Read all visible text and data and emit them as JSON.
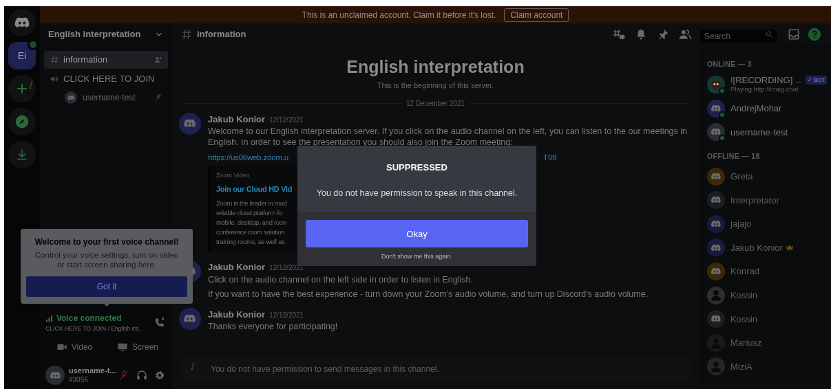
{
  "banner": {
    "text": "This is an unclaimed account. Claim it before it's lost.",
    "button": "Claim account"
  },
  "servers": [
    {
      "kind": "home",
      "selected": false
    },
    {
      "kind": "server",
      "label": "Ei",
      "selected": true
    },
    {
      "kind": "add",
      "selected": false
    },
    {
      "kind": "explore",
      "selected": false
    },
    {
      "kind": "download",
      "selected": false
    }
  ],
  "server_name": "English interpretation",
  "channels": [
    {
      "kind": "text",
      "name": "information",
      "selected": true
    },
    {
      "kind": "voice",
      "name": "CLICK HERE TO JOIN",
      "selected": false,
      "users": [
        {
          "name": "username-test"
        }
      ]
    }
  ],
  "tooltip": {
    "title": "Welcome to your first voice channel!",
    "body": "Control your voice settings, turn on video or start screen sharing here.",
    "button": "Got it"
  },
  "voice_panel": {
    "status": "Voice connected",
    "channel": "CLICK HERE TO JOIN / English int...",
    "buttons": [
      {
        "kind": "video",
        "label": "Video"
      },
      {
        "kind": "screen",
        "label": "Screen"
      }
    ]
  },
  "user_panel": {
    "name": "username-t...",
    "tag": "#3056",
    "muted": true
  },
  "chat_header": {
    "channel": "information",
    "search_placeholder": "Search"
  },
  "intro": {
    "title": "English interpretation",
    "subtitle": "This is the beginning of this server.",
    "date": "12 December 2021"
  },
  "messages": [
    {
      "author": "Jakub Konior",
      "time": "12/12/2021",
      "lines": [
        "Welcome to our English interpretation server. If you click on the audio channel on the left, you can listen to the our meetings in",
        "English. In order to see the presentation you should also join the Zoom meeting:"
      ],
      "link_start": "https://us06web.zoom.u",
      "link_end": "T09",
      "embed": {
        "provider": "Zoom Video",
        "title": "Join our Cloud HD Vid",
        "lines": [
          "Zoom is the leader in mod",
          "reliable cloud platform fo",
          "mobile, desktop, and roon",
          "conference room solution",
          "training rooms, as well as"
        ]
      }
    },
    {
      "author": "Jakub Konior",
      "time": "12/12/2021",
      "lines": [
        "Click on the audio channel on the left side in order to listen in English.",
        "If you want to have the best experience - turn down your Zoom's audio volume, and turn up Discord's audio volume."
      ]
    },
    {
      "author": "Jakub Konior",
      "time": "12/12/2021",
      "lines": [
        "Thanks everyone for participating!"
      ]
    }
  ],
  "composer_notice": "You do not have permission to send messages in this channel.",
  "members": {
    "online_header": "ONLINE — 3",
    "online": [
      {
        "name": "![RECORDING] ...",
        "activity": "Playing http://craig.chat",
        "badge": "✓ BOT",
        "kind": "bot",
        "color": "#12393a"
      },
      {
        "name": "AndrejMohar",
        "kind": "default",
        "color": "#1e2250"
      },
      {
        "name": "username-test",
        "kind": "default",
        "color": "#2a2d31"
      }
    ],
    "offline_header": "OFFLINE — 18",
    "offline": [
      {
        "name": "Greta",
        "kind": "default",
        "color": "#3a2808",
        "owner": false
      },
      {
        "name": "Interpretator",
        "kind": "default",
        "color": "#1c1f22",
        "owner": false
      },
      {
        "name": "jajajo",
        "kind": "default",
        "color": "#181b40",
        "owner": false
      },
      {
        "name": "Jakub Konior",
        "kind": "default",
        "color": "#181b40",
        "owner": true
      },
      {
        "name": "Konrad",
        "kind": "default",
        "color": "#3a2808",
        "owner": false
      },
      {
        "name": "Kossin",
        "kind": "photo",
        "color": "#2e2e2e",
        "owner": false
      },
      {
        "name": "Kossin",
        "kind": "default",
        "color": "#1c1f22",
        "owner": false
      },
      {
        "name": "Mariusz",
        "kind": "photo",
        "color": "#1a1a1a",
        "owner": false
      },
      {
        "name": "MiziA",
        "kind": "photo",
        "color": "#262626",
        "owner": false
      }
    ]
  },
  "modal": {
    "title": "SUPPRESSED",
    "body": "You do not have permission to speak in this channel.",
    "button": "Okay",
    "link": "Don't show me this again."
  }
}
